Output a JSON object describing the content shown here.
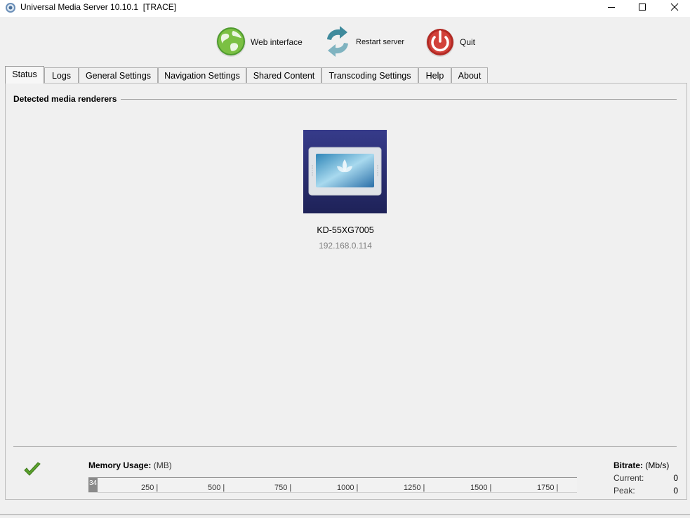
{
  "window": {
    "title": "Universal Media Server 10.10.1  [TRACE]"
  },
  "toolbar": {
    "web_label": "Web interface",
    "restart_label": "Restart server",
    "quit_label": "Quit"
  },
  "tabs": [
    {
      "label": "Status",
      "active": true
    },
    {
      "label": "Logs"
    },
    {
      "label": "General Settings"
    },
    {
      "label": "Navigation Settings"
    },
    {
      "label": "Shared Content"
    },
    {
      "label": "Transcoding Settings"
    },
    {
      "label": "Help"
    },
    {
      "label": "About"
    }
  ],
  "status": {
    "section_title": "Detected media renderers",
    "renderers": [
      {
        "name": "KD-55XG7005",
        "ip": "192.168.0.114"
      }
    ],
    "memory": {
      "label": "Memory Usage:",
      "unit": "(MB)",
      "used": "34",
      "ticks": [
        "250 |",
        "500 |",
        "750 |",
        "1000 |",
        "1250 |",
        "1500 |",
        "1750 |"
      ]
    },
    "bitrate": {
      "label": "Bitrate:",
      "unit": "(Mb/s)",
      "current_label": "Current:",
      "current_value": "0",
      "peak_label": "Peak:",
      "peak_value": "0"
    }
  },
  "colors": {
    "accent_check": "#5aa02c",
    "quit_red": "#c0392b",
    "globe_green": "#6ab04c"
  }
}
